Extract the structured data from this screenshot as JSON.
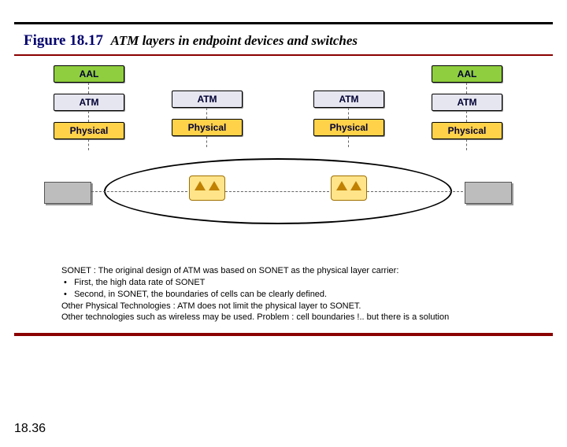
{
  "pagenum": "18.36",
  "figure": {
    "num": "Figure 18.17",
    "caption": "ATM layers in endpoint devices and switches"
  },
  "layers": {
    "aal": "AAL",
    "atm": "ATM",
    "phy": "Physical"
  },
  "notes": {
    "l1": "SONET : The original design of ATM was based on SONET as the physical layer carrier:",
    "b1": "First, the high data rate of SONET",
    "b2": "Second, in SONET, the boundaries of cells can be clearly defined.",
    "l2": "Other Physical Technologies :  ATM does not limit the physical layer to SONET.",
    "l3": "Other technologies such as wireless may be used. Problem : cell boundaries !.. but  there is a solution"
  }
}
